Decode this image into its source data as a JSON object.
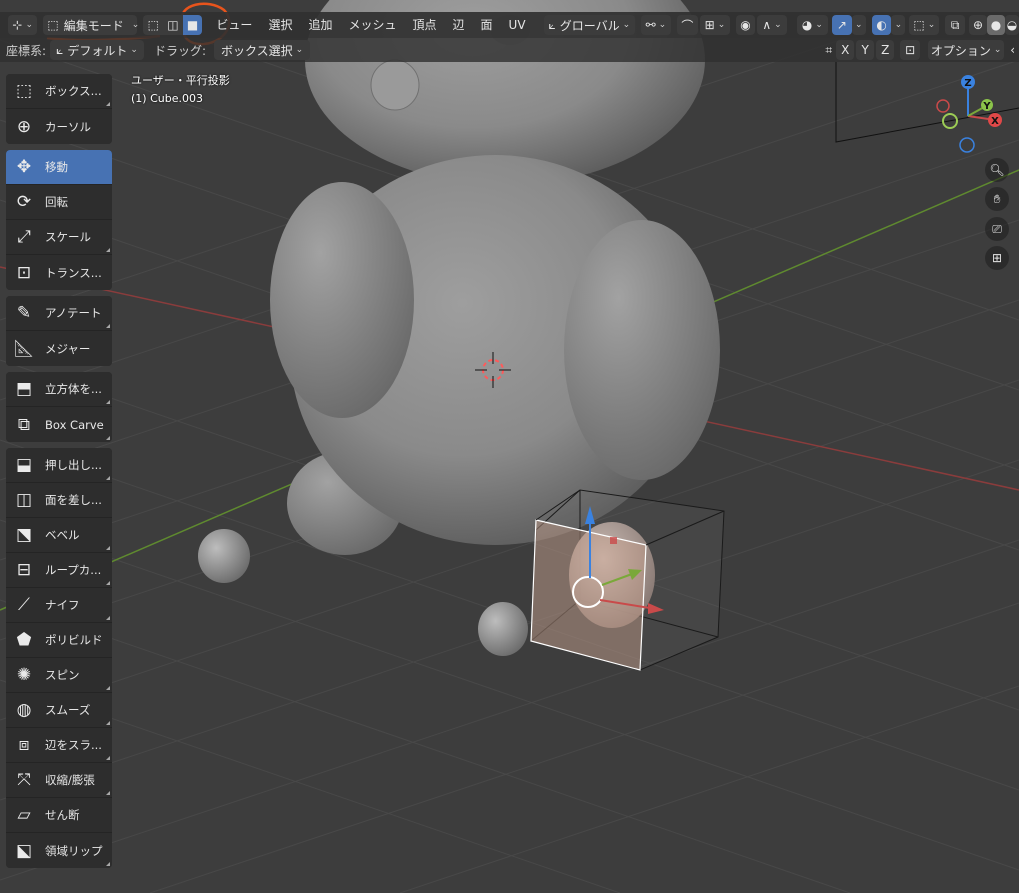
{
  "header": {
    "mode_label": "編集モード",
    "menus": [
      "ビュー",
      "選択",
      "追加",
      "メッシュ",
      "頂点",
      "辺",
      "面",
      "UV"
    ],
    "transform_orientation": "グローバル"
  },
  "subheader": {
    "coord_label": "座標系:",
    "coord_value": "デフォルト",
    "drag_label": "ドラッグ:",
    "drag_value": "ボックス選択",
    "axes": [
      "X",
      "Y",
      "Z"
    ],
    "options_label": "オプション"
  },
  "viewport": {
    "view_name": "ユーザー・平行投影",
    "object_name": "(1) Cube.003"
  },
  "gizmo": {
    "x": "X",
    "y": "Y",
    "z": "Z"
  },
  "toolbar": {
    "groups": [
      [
        {
          "label": "ボックス...",
          "icon": "select-box-icon",
          "active": false,
          "corner": true
        },
        {
          "label": "カーソル",
          "icon": "cursor-icon",
          "active": false,
          "corner": false
        }
      ],
      [
        {
          "label": "移動",
          "icon": "move-icon",
          "active": true,
          "corner": false
        },
        {
          "label": "回転",
          "icon": "rotate-icon",
          "active": false,
          "corner": false
        },
        {
          "label": "スケール",
          "icon": "scale-icon",
          "active": false,
          "corner": true
        },
        {
          "label": "トランス...",
          "icon": "transform-icon",
          "active": false,
          "corner": false
        }
      ],
      [
        {
          "label": "アノテート",
          "icon": "annotate-icon",
          "active": false,
          "corner": true
        },
        {
          "label": "メジャー",
          "icon": "measure-icon",
          "active": false,
          "corner": false
        }
      ],
      [
        {
          "label": "立方体を...",
          "icon": "add-cube-icon",
          "active": false,
          "corner": true
        },
        {
          "label": "Box Carve",
          "icon": "box-carve-icon",
          "active": false,
          "corner": true
        }
      ],
      [
        {
          "label": "押し出し...",
          "icon": "extrude-icon",
          "active": false,
          "corner": true
        },
        {
          "label": "面を差し...",
          "icon": "inset-icon",
          "active": false,
          "corner": false
        },
        {
          "label": "ベベル",
          "icon": "bevel-icon",
          "active": false,
          "corner": true
        },
        {
          "label": "ループカ...",
          "icon": "loop-cut-icon",
          "active": false,
          "corner": true
        },
        {
          "label": "ナイフ",
          "icon": "knife-icon",
          "active": false,
          "corner": true
        },
        {
          "label": "ポリビルド",
          "icon": "poly-build-icon",
          "active": false,
          "corner": false
        },
        {
          "label": "スピン",
          "icon": "spin-icon",
          "active": false,
          "corner": true
        },
        {
          "label": "スムーズ",
          "icon": "smooth-icon",
          "active": false,
          "corner": true
        },
        {
          "label": "辺をスラ...",
          "icon": "edge-slide-icon",
          "active": false,
          "corner": true
        },
        {
          "label": "収縮/膨張",
          "icon": "shrink-fatten-icon",
          "active": false,
          "corner": true
        },
        {
          "label": "せん断",
          "icon": "shear-icon",
          "active": false,
          "corner": false
        },
        {
          "label": "領域リップ",
          "icon": "rip-region-icon",
          "active": false,
          "corner": true
        }
      ]
    ]
  },
  "colors": {
    "accent": "#4772b3",
    "annotation": "#e8541c",
    "x_axis": "#c94a4a",
    "y_axis": "#7aa83a",
    "z_axis": "#3a82e0"
  }
}
